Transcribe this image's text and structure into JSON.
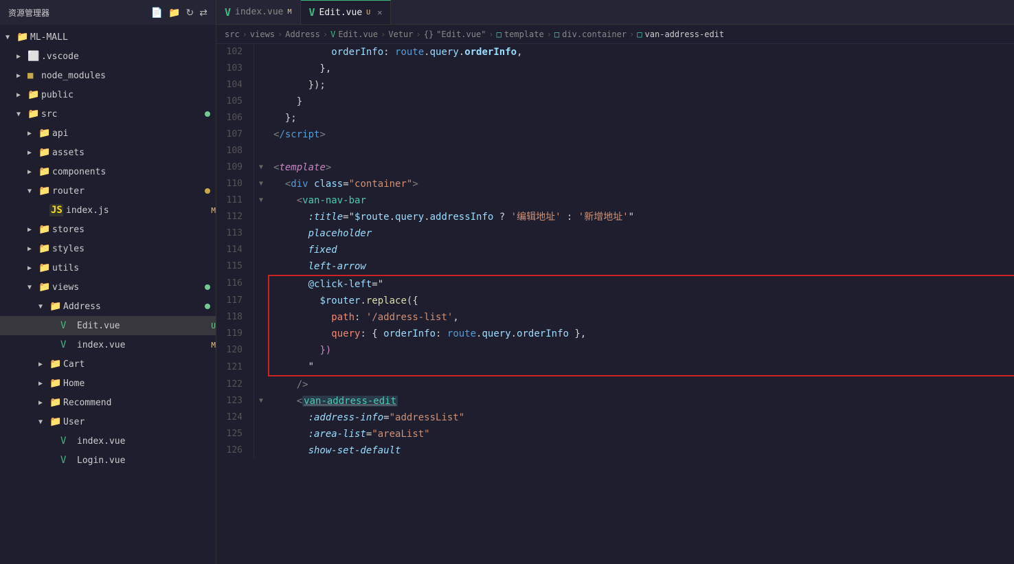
{
  "sidebar": {
    "title": "资源管理器",
    "root": "ML-MALL",
    "items": [
      {
        "id": "vscode",
        "label": ".vscode",
        "type": "folder",
        "icon": "vscode",
        "indent": 1,
        "collapsed": true
      },
      {
        "id": "node_modules",
        "label": "node_modules",
        "type": "folder",
        "icon": "node",
        "indent": 1,
        "collapsed": true
      },
      {
        "id": "public",
        "label": "public",
        "type": "folder",
        "icon": "folder",
        "indent": 1,
        "collapsed": true
      },
      {
        "id": "src",
        "label": "src",
        "type": "folder",
        "icon": "folder",
        "indent": 1,
        "collapsed": false,
        "badge": "dot-green"
      },
      {
        "id": "api",
        "label": "api",
        "type": "folder",
        "icon": "folder",
        "indent": 2,
        "collapsed": true
      },
      {
        "id": "assets",
        "label": "assets",
        "type": "folder",
        "icon": "folder",
        "indent": 2,
        "collapsed": true
      },
      {
        "id": "components",
        "label": "components",
        "type": "folder",
        "icon": "folder",
        "indent": 2,
        "collapsed": true
      },
      {
        "id": "router",
        "label": "router",
        "type": "folder",
        "icon": "folder",
        "indent": 2,
        "collapsed": false,
        "badge": "dot-olive"
      },
      {
        "id": "index-js",
        "label": "index.js",
        "type": "js",
        "indent": 3,
        "modifier": "M"
      },
      {
        "id": "stores",
        "label": "stores",
        "type": "folder",
        "icon": "folder",
        "indent": 2,
        "collapsed": true
      },
      {
        "id": "styles",
        "label": "styles",
        "type": "folder",
        "icon": "folder",
        "indent": 2,
        "collapsed": true
      },
      {
        "id": "utils",
        "label": "utils",
        "type": "folder",
        "icon": "folder",
        "indent": 2,
        "collapsed": true
      },
      {
        "id": "views",
        "label": "views",
        "type": "folder",
        "icon": "folder",
        "indent": 2,
        "collapsed": false,
        "badge": "dot-green"
      },
      {
        "id": "address",
        "label": "Address",
        "type": "folder",
        "icon": "folder",
        "indent": 3,
        "collapsed": false,
        "badge": "dot-green"
      },
      {
        "id": "edit-vue",
        "label": "Edit.vue",
        "type": "vue",
        "indent": 4,
        "modifier": "U",
        "active": true
      },
      {
        "id": "index-vue-addr",
        "label": "index.vue",
        "type": "vue",
        "indent": 4,
        "modifier": "M"
      },
      {
        "id": "cart",
        "label": "Cart",
        "type": "folder",
        "icon": "folder",
        "indent": 3,
        "collapsed": true
      },
      {
        "id": "home",
        "label": "Home",
        "type": "folder",
        "icon": "folder",
        "indent": 3,
        "collapsed": true
      },
      {
        "id": "recommend",
        "label": "Recommend",
        "type": "folder",
        "icon": "folder",
        "indent": 3,
        "collapsed": true
      },
      {
        "id": "user",
        "label": "User",
        "type": "folder",
        "icon": "folder",
        "indent": 3,
        "collapsed": false
      },
      {
        "id": "user-index",
        "label": "index.vue",
        "type": "vue",
        "indent": 4
      },
      {
        "id": "user-login",
        "label": "Login.vue",
        "type": "vue",
        "indent": 4
      }
    ]
  },
  "tabs": [
    {
      "id": "index-vue",
      "label": "index.vue",
      "modifier": "M",
      "active": false
    },
    {
      "id": "edit-vue",
      "label": "Edit.vue",
      "modifier": "U",
      "active": true,
      "closable": true
    }
  ],
  "breadcrumb": {
    "parts": [
      "src",
      ">",
      "views",
      ">",
      "Address",
      ">",
      "Edit.vue",
      ">",
      "Vetur",
      ">",
      "{}",
      "\"Edit.vue\"",
      ">",
      "template",
      ">",
      "div.container",
      ">",
      "van-address-edit"
    ]
  },
  "code": {
    "lines": [
      {
        "num": 102,
        "arrow": "",
        "content": "orderInfo_line",
        "highlight": false
      },
      {
        "num": 103,
        "arrow": "",
        "content": "comma_line",
        "highlight": false
      },
      {
        "num": 104,
        "arrow": "",
        "content": "close_paren_line",
        "highlight": false
      },
      {
        "num": 105,
        "arrow": "",
        "content": "close_brace_line",
        "highlight": false
      },
      {
        "num": 106,
        "arrow": "",
        "content": "semicolon_line",
        "highlight": false
      },
      {
        "num": 107,
        "arrow": "",
        "content": "close_script_line",
        "highlight": false
      },
      {
        "num": 108,
        "arrow": "",
        "content": "empty",
        "highlight": false
      },
      {
        "num": 109,
        "arrow": "▼",
        "content": "template_open",
        "highlight": false
      },
      {
        "num": 110,
        "arrow": "▼",
        "content": "div_container",
        "highlight": false
      },
      {
        "num": 111,
        "arrow": "▼",
        "content": "van_nav_bar",
        "highlight": false
      },
      {
        "num": 112,
        "arrow": "",
        "content": "title_line",
        "highlight": false
      },
      {
        "num": 113,
        "arrow": "",
        "content": "placeholder_line",
        "highlight": false
      },
      {
        "num": 114,
        "arrow": "",
        "content": "fixed_line",
        "highlight": false
      },
      {
        "num": 115,
        "arrow": "",
        "content": "left_arrow_line",
        "highlight": false
      },
      {
        "num": 116,
        "arrow": "",
        "content": "click_left_start",
        "highlight": true,
        "htype": "start"
      },
      {
        "num": 117,
        "arrow": "",
        "content": "router_replace_line",
        "highlight": true,
        "htype": "mid"
      },
      {
        "num": 118,
        "arrow": "",
        "content": "path_line",
        "highlight": true,
        "htype": "mid"
      },
      {
        "num": 119,
        "arrow": "",
        "content": "query_line",
        "highlight": true,
        "htype": "mid"
      },
      {
        "num": 120,
        "arrow": "",
        "content": "close_router_line",
        "highlight": true,
        "htype": "mid"
      },
      {
        "num": 121,
        "arrow": "",
        "content": "quote_close_line",
        "highlight": true,
        "htype": "end"
      },
      {
        "num": 122,
        "arrow": "",
        "content": "close_tag_line",
        "highlight": false
      },
      {
        "num": 123,
        "arrow": "▼",
        "content": "van_address_edit",
        "highlight": false
      },
      {
        "num": 124,
        "arrow": "",
        "content": "address_info_line",
        "highlight": false
      },
      {
        "num": 125,
        "arrow": "",
        "content": "area_list_line",
        "highlight": false
      },
      {
        "num": 126,
        "arrow": "",
        "content": "show_set_default",
        "highlight": false
      }
    ]
  }
}
